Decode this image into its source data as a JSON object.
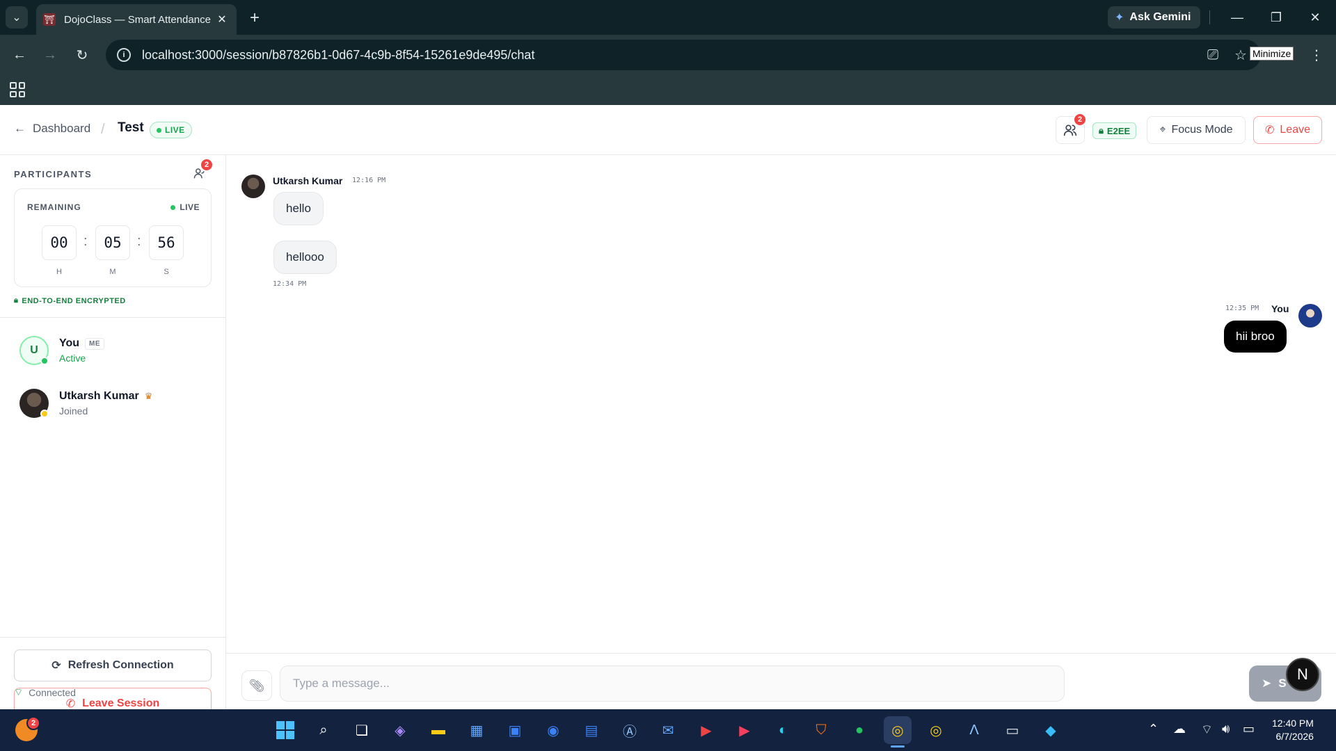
{
  "browser": {
    "tab_title": "DojoClass — Smart Attendance",
    "new_tab": "+",
    "gemini_label": "Ask Gemini",
    "url": "localhost:3000/session/b87826b1-0d67-4c9b-8f54-15261e9de495/chat",
    "tooltip": "Minimize",
    "win_min": "—",
    "win_restore": "❐",
    "win_close": "✕"
  },
  "header": {
    "back_label": "Dashboard",
    "crumb_sep": "/",
    "session_title": "Test",
    "live_label": "LIVE",
    "participants_count": "2",
    "e2ee_label": "E2EE",
    "focus_label": "Focus Mode",
    "leave_label": "Leave"
  },
  "sidebar": {
    "title": "PARTICIPANTS",
    "count": "2",
    "timer": {
      "label": "REMAINING",
      "live": "LIVE",
      "hours": "00",
      "minutes": "05",
      "seconds": "56",
      "h_unit": "H",
      "m_unit": "M",
      "s_unit": "S",
      "colon": ":"
    },
    "encrypted": "END-TO-END ENCRYPTED",
    "members": [
      {
        "initial": "U",
        "name": "You",
        "tag": "ME",
        "status": "Active"
      },
      {
        "name": "Utkarsh Kumar",
        "status": "Joined"
      }
    ],
    "refresh_label": "Refresh Connection",
    "leave_label": "Leave Session",
    "connection_status": "Connected"
  },
  "chat": {
    "messages_in": {
      "sender": "Utkarsh Kumar",
      "time_first": "12:16 PM",
      "bubbles": [
        "hello",
        "hellooo"
      ],
      "time_last": "12:34 PM"
    },
    "message_out": {
      "sender": "You",
      "time": "12:35 PM",
      "text": "hii broo"
    },
    "input_placeholder": "Type a message...",
    "send_label": "S"
  },
  "fab_label": "N",
  "taskbar": {
    "notif_count": "2",
    "time": "12:40 PM",
    "date": "6/7/2026"
  },
  "colors": {
    "accent_green": "#16a34a",
    "danger": "#ef4444",
    "chrome_dark": "#0f2227",
    "chrome": "#27393d"
  }
}
